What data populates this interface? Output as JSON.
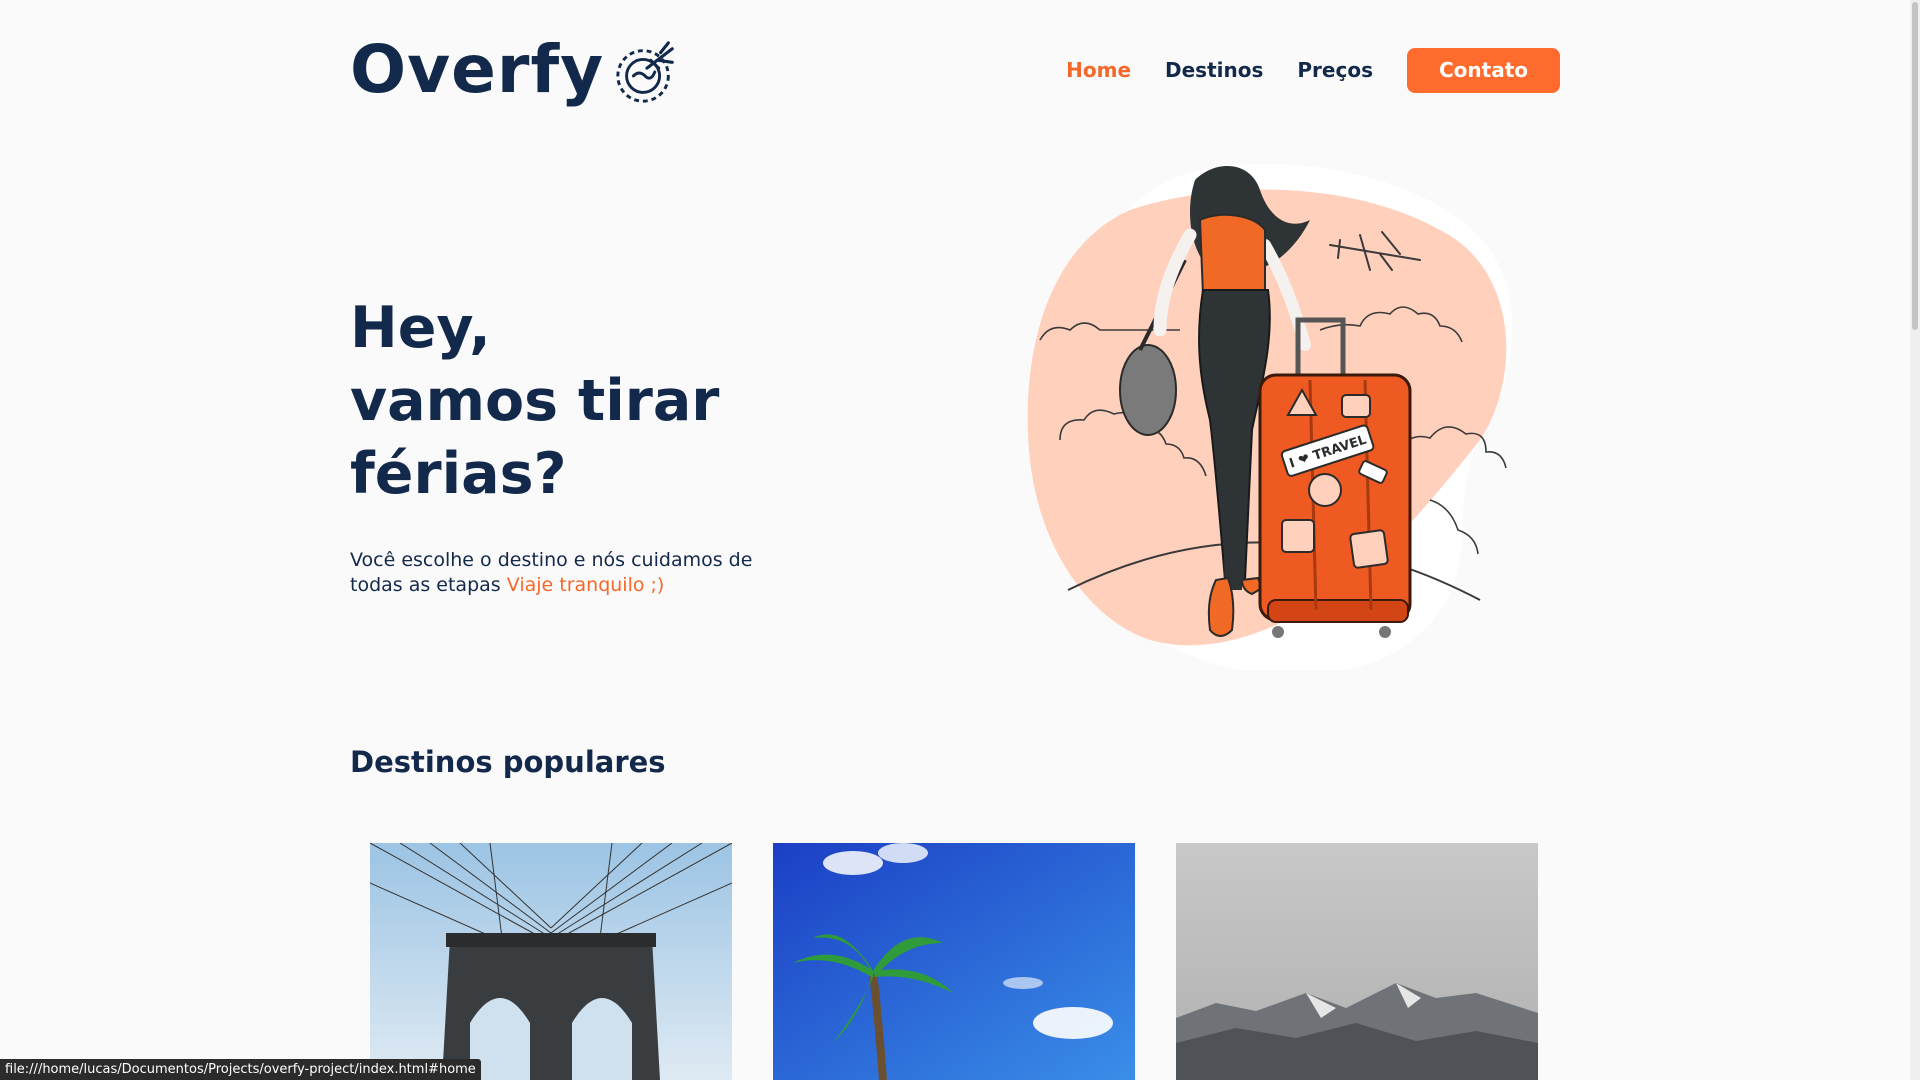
{
  "brand": {
    "name": "Overfy",
    "logo_icon": "globe-plane-icon"
  },
  "nav": {
    "items": [
      {
        "label": "Home",
        "active": true
      },
      {
        "label": "Destinos",
        "active": false
      },
      {
        "label": "Preços",
        "active": false
      }
    ],
    "cta_label": "Contato"
  },
  "hero": {
    "title_lines": [
      "Hey,",
      "vamos tirar",
      "férias?"
    ],
    "description": "Você escolhe o destino e nós cuidamos de todas as etapas",
    "description_accent": "Viaje tranquilo ;)",
    "illustration": "traveler-with-suitcase-illustration",
    "suitcase_sticker": "I ❤ TRAVEL"
  },
  "destinations": {
    "title": "Destinos populares",
    "cards": [
      {
        "image": "brooklyn-bridge-photo"
      },
      {
        "image": "palm-tree-sky-photo"
      },
      {
        "image": "misty-mountains-photo"
      }
    ]
  },
  "statusbar": {
    "url": "file:///home/lucas/Documentos/Projects/overfy-project/index.html#home"
  },
  "colors": {
    "accent": "#fe6b2c",
    "accent_text": "#f5682a",
    "primary": "#13294b",
    "background": "#fafafa",
    "blob": "#ffd0bc"
  }
}
